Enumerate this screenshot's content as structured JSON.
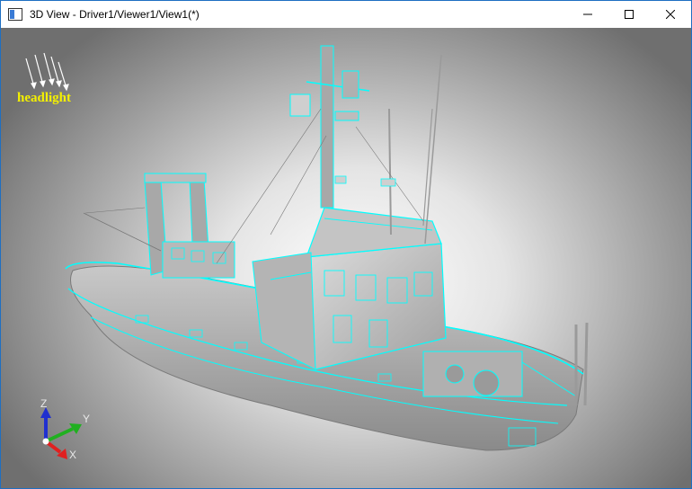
{
  "window": {
    "title": "3D View - Driver1/Viewer1/View1(*)",
    "controls": [
      "minimize-icon",
      "maximize-icon",
      "close-icon"
    ]
  },
  "viewport": {
    "headlight_label": "headlight",
    "axes": {
      "x": "X",
      "y": "Y",
      "z": "Z"
    },
    "colors": {
      "wireframe": "#00ffff",
      "axis_x": "#e02020",
      "axis_y": "#20b020",
      "axis_z": "#2030d0",
      "headlight": "#f4f000"
    }
  }
}
